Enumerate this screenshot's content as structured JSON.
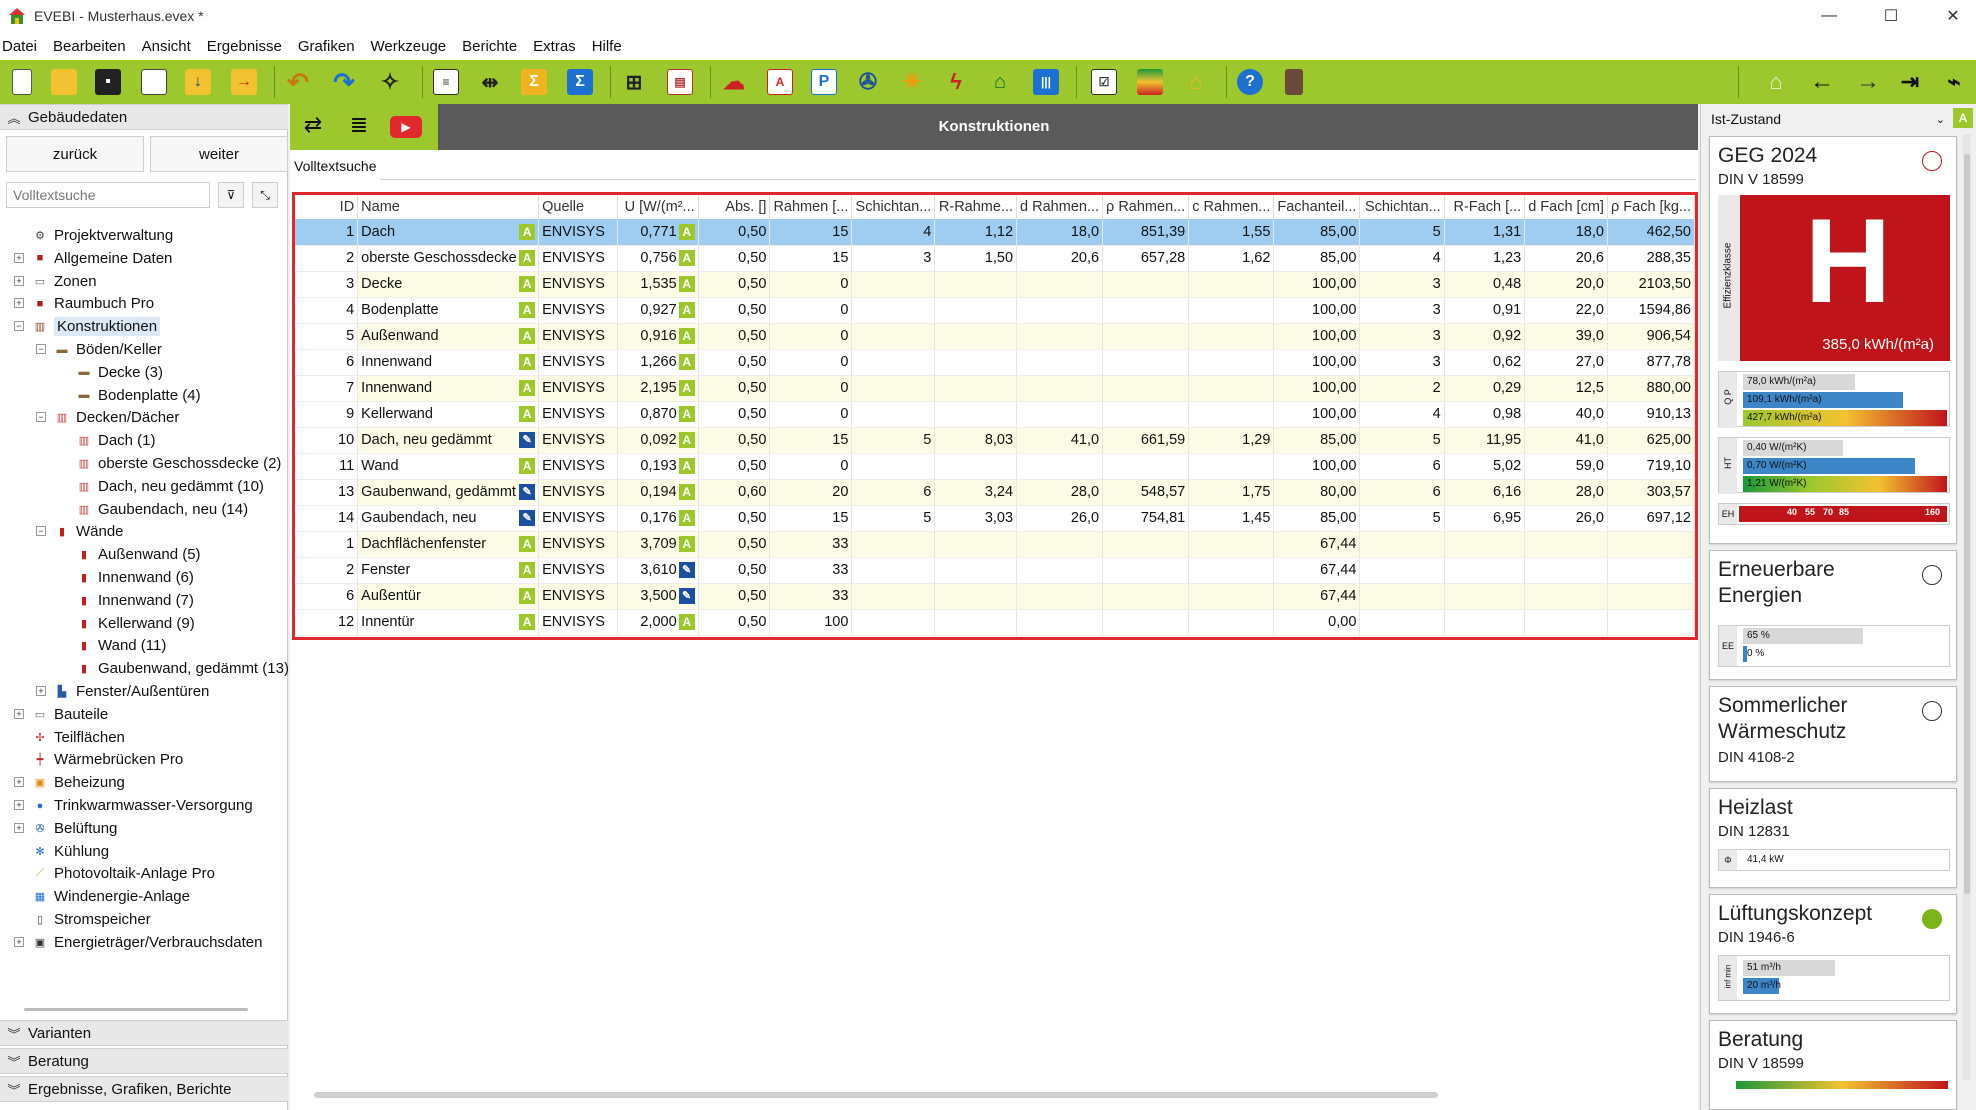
{
  "window": {
    "title": "EVEBI - Musterhaus.evex *"
  },
  "menu": [
    "Datei",
    "Bearbeiten",
    "Ansicht",
    "Ergebnisse",
    "Grafiken",
    "Werkzeuge",
    "Berichte",
    "Extras",
    "Hilfe"
  ],
  "left": {
    "section_title": "Gebäudedaten",
    "back_label": "zurück",
    "next_label": "weiter",
    "search_placeholder": "Volltextsuche",
    "tree": [
      {
        "label": "Projektverwaltung",
        "icon": "wrench-icon"
      },
      {
        "label": "Allgemeine Daten",
        "icon": "book-icon"
      },
      {
        "label": "Zonen",
        "icon": "folder-icon"
      },
      {
        "label": "Raumbuch Pro",
        "icon": "book-icon"
      },
      {
        "label": "Konstruktionen",
        "icon": "construction-icon"
      },
      {
        "label": "Böden/Keller",
        "icon": "floor-icon"
      },
      {
        "label": "Decke (3)",
        "icon": "slab-icon"
      },
      {
        "label": "Bodenplatte (4)",
        "icon": "slab-icon"
      },
      {
        "label": "Decken/Dächer",
        "icon": "roof-icon"
      },
      {
        "label": "Dach (1)",
        "icon": "roof-icon"
      },
      {
        "label": "oberste Geschossdecke (2)",
        "icon": "roof-icon"
      },
      {
        "label": "Dach, neu gedämmt (10)",
        "icon": "roof-icon"
      },
      {
        "label": "Gaubendach, neu (14)",
        "icon": "roof-icon"
      },
      {
        "label": "Wände",
        "icon": "wall-icon"
      },
      {
        "label": "Außenwand (5)",
        "icon": "wall-icon"
      },
      {
        "label": "Innenwand (6)",
        "icon": "wall-icon"
      },
      {
        "label": "Innenwand (7)",
        "icon": "wall-icon"
      },
      {
        "label": "Kellerwand (9)",
        "icon": "wall-icon"
      },
      {
        "label": "Wand (11)",
        "icon": "wall-icon"
      },
      {
        "label": "Gaubenwand, gedämmt (13)",
        "icon": "wall-icon"
      },
      {
        "label": "Fenster/Außentüren",
        "icon": "window-icon"
      },
      {
        "label": "Bauteile",
        "icon": "folder-icon"
      },
      {
        "label": "Teilflächen",
        "icon": "area-icon"
      },
      {
        "label": "Wärmebrücken Pro",
        "icon": "bridge-icon"
      },
      {
        "label": "Beheizung",
        "icon": "heating-icon"
      },
      {
        "label": "Trinkwarmwasser-Versorgung",
        "icon": "water-drop-icon"
      },
      {
        "label": "Belüftung",
        "icon": "fan-icon"
      },
      {
        "label": "Kühlung",
        "icon": "snowflake-icon"
      },
      {
        "label": "Photovoltaik-Anlage Pro",
        "icon": "solar-icon"
      },
      {
        "label": "Windenergie-Anlage",
        "icon": "wind-icon"
      },
      {
        "label": "Stromspeicher",
        "icon": "battery-icon"
      },
      {
        "label": "Energieträger/Verbrauchsdaten",
        "icon": "fuel-icon"
      }
    ],
    "bottom_sections": [
      "Varianten",
      "Beratung",
      "Ergebnisse, Grafiken, Berichte"
    ]
  },
  "center": {
    "title": "Konstruktionen",
    "fulltext_label": "Volltextsuche",
    "columns": [
      "ID",
      "Name",
      "Quelle",
      "U [W/(m²...",
      "Abs. []",
      "Rahmen [...",
      "Schichtan...",
      "R-Rahme...",
      "d Rahmen...",
      "ρ Rahmen...",
      "c Rahmen...",
      "Fachanteil...",
      "Schichtan...",
      "R-Fach  [...",
      "d Fach [cm]",
      "ρ Fach [kg..."
    ],
    "rows": [
      {
        "id": "1",
        "name": "Dach",
        "badge": "A",
        "quelle": "ENVISYS",
        "u": "0,771",
        "ub": "A",
        "abs": "0,50",
        "rahmen": "15",
        "schicht": "4",
        "rr": "1,12",
        "dr": "18,0",
        "rhor": "851,39",
        "cr": "1,55",
        "fach": "85,00",
        "schicht2": "5",
        "rf": "1,31",
        "df": "18,0",
        "rhof": "462,50"
      },
      {
        "id": "2",
        "name": "oberste Geschossdecke",
        "badge": "A",
        "quelle": "ENVISYS",
        "u": "0,756",
        "ub": "A",
        "abs": "0,50",
        "rahmen": "15",
        "schicht": "3",
        "rr": "1,50",
        "dr": "20,6",
        "rhor": "657,28",
        "cr": "1,62",
        "fach": "85,00",
        "schicht2": "4",
        "rf": "1,23",
        "df": "20,6",
        "rhof": "288,35"
      },
      {
        "id": "3",
        "name": "Decke",
        "badge": "A",
        "quelle": "ENVISYS",
        "u": "1,535",
        "ub": "A",
        "abs": "0,50",
        "rahmen": "0",
        "schicht": "",
        "rr": "",
        "dr": "",
        "rhor": "",
        "cr": "",
        "fach": "100,00",
        "schicht2": "3",
        "rf": "0,48",
        "df": "20,0",
        "rhof": "2103,50"
      },
      {
        "id": "4",
        "name": "Bodenplatte",
        "badge": "A",
        "quelle": "ENVISYS",
        "u": "0,927",
        "ub": "A",
        "abs": "0,50",
        "rahmen": "0",
        "schicht": "",
        "rr": "",
        "dr": "",
        "rhor": "",
        "cr": "",
        "fach": "100,00",
        "schicht2": "3",
        "rf": "0,91",
        "df": "22,0",
        "rhof": "1594,86"
      },
      {
        "id": "5",
        "name": "Außenwand",
        "badge": "A",
        "quelle": "ENVISYS",
        "u": "0,916",
        "ub": "A",
        "abs": "0,50",
        "rahmen": "0",
        "schicht": "",
        "rr": "",
        "dr": "",
        "rhor": "",
        "cr": "",
        "fach": "100,00",
        "schicht2": "3",
        "rf": "0,92",
        "df": "39,0",
        "rhof": "906,54"
      },
      {
        "id": "6",
        "name": "Innenwand",
        "badge": "A",
        "quelle": "ENVISYS",
        "u": "1,266",
        "ub": "A",
        "abs": "0,50",
        "rahmen": "0",
        "schicht": "",
        "rr": "",
        "dr": "",
        "rhor": "",
        "cr": "",
        "fach": "100,00",
        "schicht2": "3",
        "rf": "0,62",
        "df": "27,0",
        "rhof": "877,78"
      },
      {
        "id": "7",
        "name": "Innenwand",
        "badge": "A",
        "quelle": "ENVISYS",
        "u": "2,195",
        "ub": "A",
        "abs": "0,50",
        "rahmen": "0",
        "schicht": "",
        "rr": "",
        "dr": "",
        "rhor": "",
        "cr": "",
        "fach": "100,00",
        "schicht2": "2",
        "rf": "0,29",
        "df": "12,5",
        "rhof": "880,00"
      },
      {
        "id": "9",
        "name": "Kellerwand",
        "badge": "A",
        "quelle": "ENVISYS",
        "u": "0,870",
        "ub": "A",
        "abs": "0,50",
        "rahmen": "0",
        "schicht": "",
        "rr": "",
        "dr": "",
        "rhor": "",
        "cr": "",
        "fach": "100,00",
        "schicht2": "4",
        "rf": "0,98",
        "df": "40,0",
        "rhof": "910,13"
      },
      {
        "id": "10",
        "name": "Dach, neu gedämmt",
        "badge": "E",
        "quelle": "ENVISYS",
        "u": "0,092",
        "ub": "A",
        "abs": "0,50",
        "rahmen": "15",
        "schicht": "5",
        "rr": "8,03",
        "dr": "41,0",
        "rhor": "661,59",
        "cr": "1,29",
        "fach": "85,00",
        "schicht2": "5",
        "rf": "11,95",
        "df": "41,0",
        "rhof": "625,00"
      },
      {
        "id": "11",
        "name": "Wand",
        "badge": "A",
        "quelle": "ENVISYS",
        "u": "0,193",
        "ub": "A",
        "abs": "0,50",
        "rahmen": "0",
        "schicht": "",
        "rr": "",
        "dr": "",
        "rhor": "",
        "cr": "",
        "fach": "100,00",
        "schicht2": "6",
        "rf": "5,02",
        "df": "59,0",
        "rhof": "719,10"
      },
      {
        "id": "13",
        "name": "Gaubenwand, gedämmt",
        "badge": "E",
        "quelle": "ENVISYS",
        "u": "0,194",
        "ub": "A",
        "abs": "0,60",
        "rahmen": "20",
        "schicht": "6",
        "rr": "3,24",
        "dr": "28,0",
        "rhor": "548,57",
        "cr": "1,75",
        "fach": "80,00",
        "schicht2": "6",
        "rf": "6,16",
        "df": "28,0",
        "rhof": "303,57"
      },
      {
        "id": "14",
        "name": "Gaubendach, neu",
        "badge": "E",
        "quelle": "ENVISYS",
        "u": "0,176",
        "ub": "A",
        "abs": "0,50",
        "rahmen": "15",
        "schicht": "5",
        "rr": "3,03",
        "dr": "26,0",
        "rhor": "754,81",
        "cr": "1,45",
        "fach": "85,00",
        "schicht2": "5",
        "rf": "6,95",
        "df": "26,0",
        "rhof": "697,12"
      },
      {
        "id": "1",
        "name": "Dachflächenfenster",
        "badge": "A",
        "quelle": "ENVISYS",
        "u": "3,709",
        "ub": "A",
        "abs": "0,50",
        "rahmen": "33",
        "schicht": "",
        "rr": "",
        "dr": "",
        "rhor": "",
        "cr": "",
        "fach": "67,44",
        "schicht2": "",
        "rf": "",
        "df": "",
        "rhof": ""
      },
      {
        "id": "2",
        "name": "Fenster",
        "badge": "A",
        "quelle": "ENVISYS",
        "u": "3,610",
        "ub": "E",
        "abs": "0,50",
        "rahmen": "33",
        "schicht": "",
        "rr": "",
        "dr": "",
        "rhor": "",
        "cr": "",
        "fach": "67,44",
        "schicht2": "",
        "rf": "",
        "df": "",
        "rhof": ""
      },
      {
        "id": "6",
        "name": "Außentür",
        "badge": "A",
        "quelle": "ENVISYS",
        "u": "3,500",
        "ub": "E",
        "abs": "0,50",
        "rahmen": "33",
        "schicht": "",
        "rr": "",
        "dr": "",
        "rhor": "",
        "cr": "",
        "fach": "67,44",
        "schicht2": "",
        "rf": "",
        "df": "",
        "rhof": ""
      },
      {
        "id": "12",
        "name": "Innentür",
        "badge": "A",
        "quelle": "ENVISYS",
        "u": "2,000",
        "ub": "A",
        "abs": "0,50",
        "rahmen": "100",
        "schicht": "",
        "rr": "",
        "dr": "",
        "rhor": "",
        "cr": "",
        "fach": "0,00",
        "schicht2": "",
        "rf": "",
        "df": "",
        "rhof": ""
      }
    ]
  },
  "right": {
    "state": "Ist-Zustand",
    "state_badge": "A",
    "geg": {
      "title": "GEG 2024",
      "subtitle": "DIN V 18599",
      "class_letter": "H",
      "class_caption": "Effizienzklasse",
      "value": "385,0 kWh/(m²a)",
      "status_color": "#c0141b",
      "qp_label": "Q P",
      "qp": [
        "78,0 kWh/(m²a)",
        "109,1 kWh/(m²a)",
        "427,7 kWh/(m²a)"
      ],
      "ht_label": "HT",
      "ht": [
        "0,40 W/(m²K)",
        "0,70 W/(m²K)",
        "1,21 W/(m²K)"
      ],
      "eh_label": "EH",
      "eh": [
        "40",
        "55",
        "70",
        "85",
        "160"
      ]
    },
    "ee": {
      "title_line1": "Erneuerbare",
      "title_line2": "Energien",
      "label": "EE",
      "values": [
        "65 %",
        "0 %"
      ],
      "fraction": 0
    },
    "summer": {
      "title_line1": "Sommerlicher",
      "title_line2": "Wärmeschutz",
      "subtitle": "DIN 4108-2"
    },
    "heat": {
      "title": "Heizlast",
      "subtitle": "DIN 12831",
      "label": "Φ",
      "value": "41,4 kW"
    },
    "vent": {
      "title": "Lüftungskonzept",
      "subtitle": "DIN 1946-6",
      "label": "inf min",
      "values": [
        "51 m³/h",
        "20 m³/h"
      ],
      "status_color": "#7cb518"
    },
    "advice": {
      "title": "Beratung",
      "subtitle": "DIN V 18599"
    }
  }
}
